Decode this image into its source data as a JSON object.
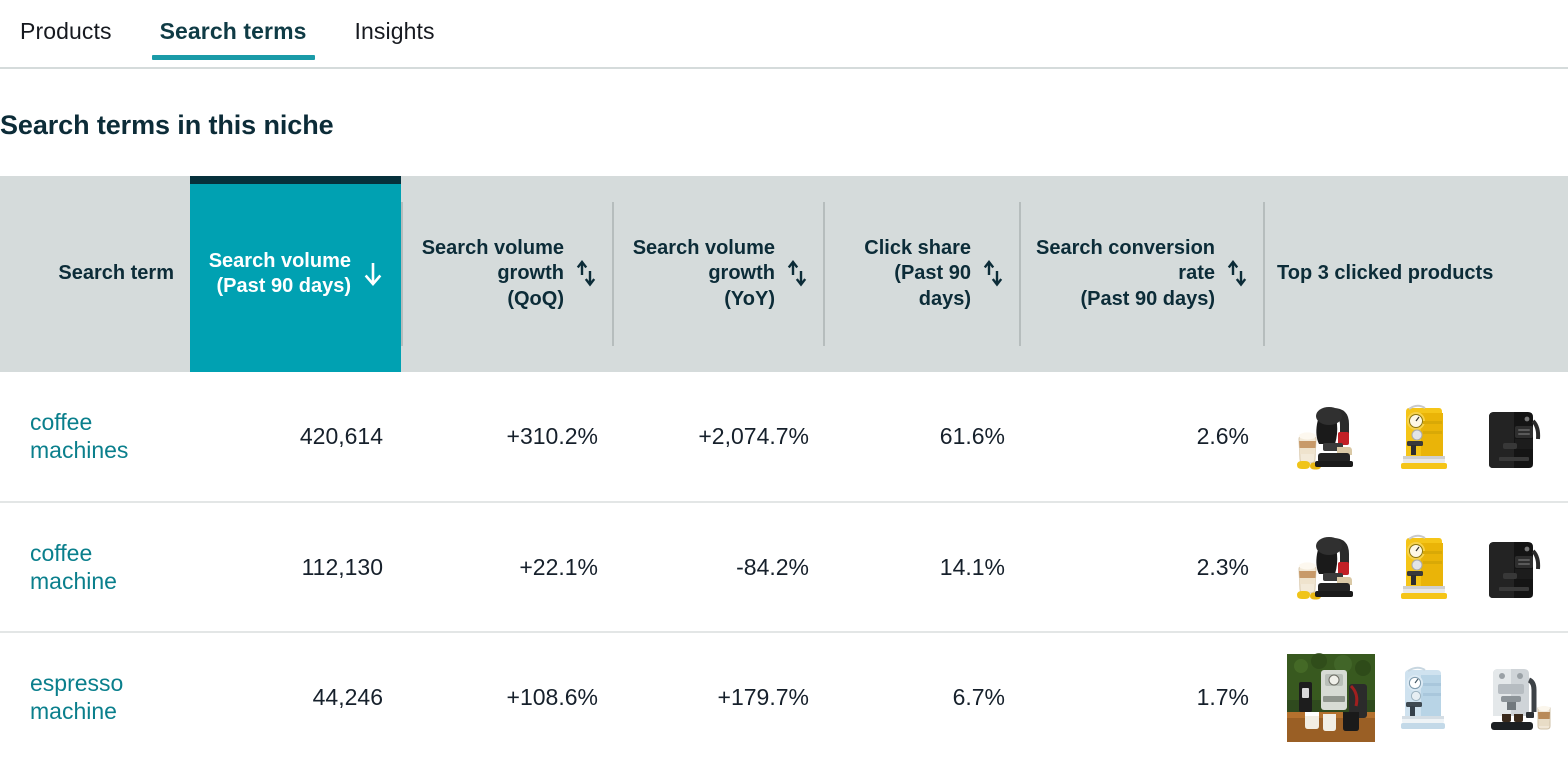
{
  "tabs": [
    {
      "label": "Products",
      "active": false
    },
    {
      "label": "Search terms",
      "active": true
    },
    {
      "label": "Insights",
      "active": false
    }
  ],
  "page": {
    "title": "Search terms in this niche"
  },
  "table": {
    "columns": [
      {
        "key": "term",
        "label": "Search term",
        "sub": "",
        "sortable": false,
        "sorted": false
      },
      {
        "key": "volume",
        "label": "Search volume",
        "sub": "(Past 90 days)",
        "sortable": true,
        "sorted": true,
        "sort_direction": "desc"
      },
      {
        "key": "growth_qoq",
        "label": "Search volume growth",
        "sub": "(QoQ)",
        "sortable": true,
        "sorted": false
      },
      {
        "key": "growth_yoy",
        "label": "Search volume growth",
        "sub": "(YoY)",
        "sortable": true,
        "sorted": false
      },
      {
        "key": "click_share",
        "label": "Click share",
        "sub": "(Past 90 days)",
        "sortable": true,
        "sorted": false
      },
      {
        "key": "conv_rate",
        "label": "Search conversion rate",
        "sub": "(Past 90 days)",
        "sortable": true,
        "sorted": false
      },
      {
        "key": "products",
        "label": "Top 3 clicked products",
        "sub": "",
        "sortable": false,
        "sorted": false
      }
    ],
    "rows": [
      {
        "term": "coffee machines",
        "volume": "420,614",
        "growth_qoq": "+310.2%",
        "growth_yoy": "+2,074.7%",
        "click_share": "61.6%",
        "conv_rate": "2.6%",
        "products": [
          "black-pod-coffee-machine-with-latte-glass",
          "yellow-espresso-machine",
          "black-capsule-coffee-machine"
        ]
      },
      {
        "term": "coffee machine",
        "volume": "112,130",
        "growth_qoq": "+22.1%",
        "growth_yoy": "-84.2%",
        "click_share": "14.1%",
        "conv_rate": "2.3%",
        "products": [
          "black-pod-coffee-machine-with-latte-glass",
          "yellow-espresso-machine",
          "black-capsule-coffee-machine"
        ]
      },
      {
        "term": "espresso machine",
        "volume": "44,246",
        "growth_qoq": "+108.6%",
        "growth_yoy": "+179.7%",
        "click_share": "6.7%",
        "conv_rate": "1.7%",
        "products": [
          "outdoor-photo-coffee-machine-set",
          "pale-blue-espresso-machine",
          "chrome-espresso-machine-with-cups"
        ]
      }
    ]
  },
  "colors": {
    "accent_teal": "#00a1b2",
    "link_teal": "#0a7f8c",
    "header_bg": "#d5dbdb",
    "dark_navy": "#06313c",
    "text": "#16202b"
  }
}
